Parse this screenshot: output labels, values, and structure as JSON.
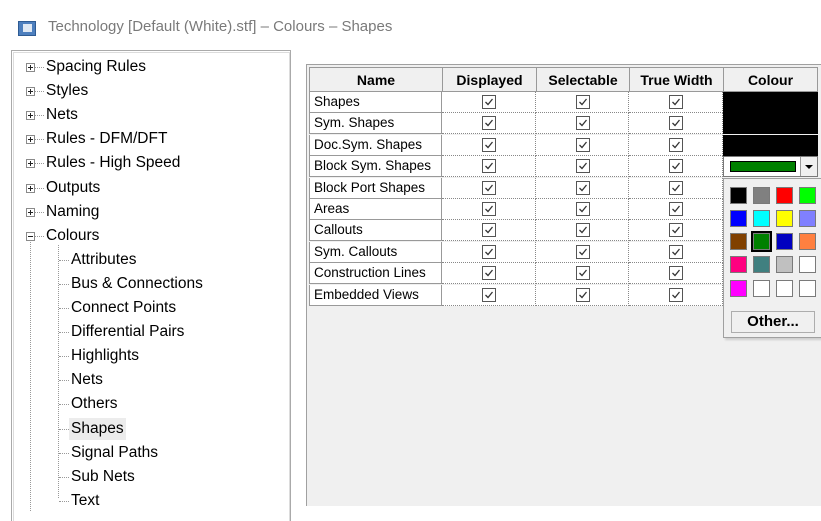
{
  "window": {
    "title": "Technology [Default (White).stf] – Colours – Shapes"
  },
  "tree": {
    "top_items": [
      {
        "label": "Spacing Rules",
        "expanded": false
      },
      {
        "label": "Styles",
        "expanded": false
      },
      {
        "label": "Nets",
        "expanded": false
      },
      {
        "label": "Rules - DFM/DFT",
        "expanded": false
      },
      {
        "label": "Rules - High Speed",
        "expanded": false
      },
      {
        "label": "Outputs",
        "expanded": false
      },
      {
        "label": "Naming",
        "expanded": false
      },
      {
        "label": "Colours",
        "expanded": true
      }
    ],
    "colour_children": [
      "Attributes",
      "Bus & Connections",
      "Connect Points",
      "Differential Pairs",
      "Highlights",
      "Nets",
      "Others",
      "Shapes",
      "Signal Paths",
      "Sub Nets",
      "Text"
    ],
    "selected": "Shapes"
  },
  "grid": {
    "columns": [
      "Name",
      "Displayed",
      "Selectable",
      "True Width",
      "Colour"
    ],
    "rows": [
      {
        "name": "Shapes",
        "displayed": true,
        "selectable": true,
        "true_width": true,
        "colour": "#000000"
      },
      {
        "name": "Sym. Shapes",
        "displayed": true,
        "selectable": true,
        "true_width": true,
        "colour": "#000000"
      },
      {
        "name": "Doc.Sym. Shapes",
        "displayed": true,
        "selectable": true,
        "true_width": true,
        "colour": "#000000"
      },
      {
        "name": "Block Sym. Shapes",
        "displayed": true,
        "selectable": true,
        "true_width": true,
        "colour": "#008000"
      },
      {
        "name": "Block Port Shapes",
        "displayed": true,
        "selectable": true,
        "true_width": true,
        "colour": null
      },
      {
        "name": "Areas",
        "displayed": true,
        "selectable": true,
        "true_width": true,
        "colour": null
      },
      {
        "name": "Callouts",
        "displayed": true,
        "selectable": true,
        "true_width": true,
        "colour": null
      },
      {
        "name": "Sym. Callouts",
        "displayed": true,
        "selectable": true,
        "true_width": true,
        "colour": null
      },
      {
        "name": "Construction Lines",
        "displayed": true,
        "selectable": true,
        "true_width": true,
        "colour": null
      },
      {
        "name": "Embedded Views",
        "displayed": true,
        "selectable": true,
        "true_width": true,
        "colour": null
      }
    ]
  },
  "colour_dropdown": {
    "current": "#008000",
    "palette": [
      [
        "#000000",
        "#808080",
        "#ff0000",
        "#00ff00"
      ],
      [
        "#0000ff",
        "#00ffff",
        "#ffff00",
        "#8080ff"
      ],
      [
        "#804000",
        "#008000",
        "#0000c0",
        "#ff8040"
      ],
      [
        "#ff0080",
        "#408080",
        "#c0c0c0",
        "#ffffff"
      ],
      [
        "#ff00ff",
        "#ffffff",
        "#ffffff",
        "#ffffff"
      ]
    ],
    "selected_index": [
      2,
      1
    ],
    "other_label": "Other..."
  }
}
